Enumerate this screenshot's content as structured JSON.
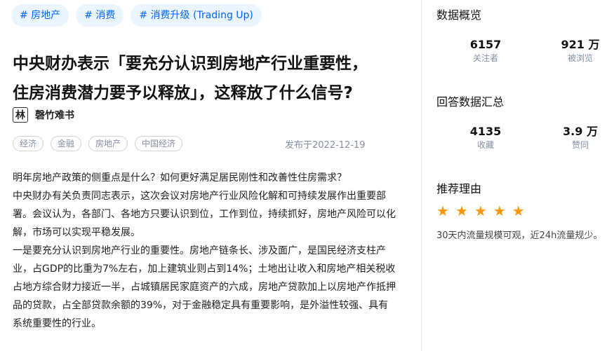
{
  "topics": [
    "# 房地产",
    "# 消费",
    "# 消费升级 (Trading Up)"
  ],
  "question": {
    "title_line1": "中央财办表示「要充分认识到房地产行业重要性，",
    "title_line2": "住房消费潜力要予以释放」，这释放了什么信号?"
  },
  "author": {
    "avatar_char": "林",
    "name": "磬竹难书"
  },
  "tags": [
    "经济",
    "金融",
    "房地产",
    "中国经济"
  ],
  "published": "发布于2022-12-19",
  "body": [
    "明年房地产政策的侧重点是什么？如何更好满足居民刚性和改善性住房需求？",
    "中央财办有关负责同志表示，这次会议对房地产行业风险化解和可持续发展作出重要部署。会议认为，各部门、各地方只要认识到位，工作到位，持续抓好，房地产风险可以化解，市场可以实现平稳发展。",
    "一是要充分认识到房地产行业的重要性。房地产链条长、涉及面广，是国民经济支柱产业，占GDP的比重为7%左右，加上建筑业则占到14%；土地出让收入和房地产相关税收占地方综合财力接近一半，占城镇居民家庭资产的六成，房地产贷款加上以房地产作抵押品的贷款，占全部贷款余额的39%，对于金融稳定具有重要影响，是外溢性较强、具有系统重要性的行业。"
  ],
  "sidebar": {
    "overview_title": "数据概览",
    "followers_value": "6157",
    "followers_label": "关注者",
    "views_value": "921 万",
    "views_label": "被浏览",
    "answer_title": "回答数据汇总",
    "favorites_value": "4135",
    "favorites_label": "收藏",
    "likes_value": "3.9 万",
    "likes_label": "赞同",
    "reason_title": "推荐理由",
    "rating": 5,
    "star_color": "#ff9607",
    "reason_text": "30天内流量规模可观，近24h流量规少。"
  },
  "colors": {
    "accent": "#0066ff",
    "chip_bg": "#ebf5ff",
    "muted": "#8590a6"
  }
}
